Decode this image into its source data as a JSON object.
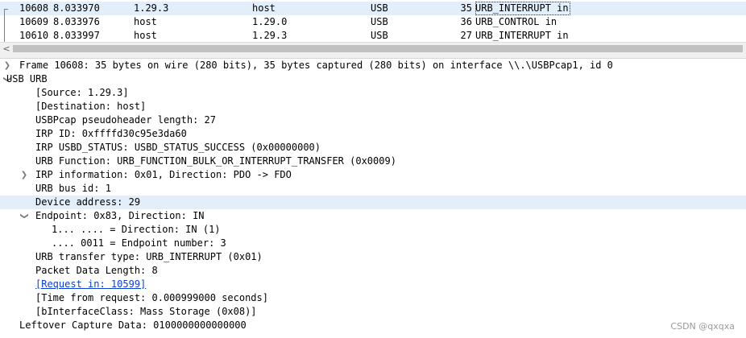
{
  "packet_list": {
    "rows": [
      {
        "no": "10608",
        "time": "8.033970",
        "source": "1.29.3",
        "destination": "host",
        "protocol": "USB",
        "length": "35",
        "info": "URB_INTERRUPT in"
      },
      {
        "no": "10609",
        "time": "8.033976",
        "source": "host",
        "destination": "1.29.0",
        "protocol": "USB",
        "length": "36",
        "info": "URB_CONTROL in"
      },
      {
        "no": "10610",
        "time": "8.033997",
        "source": "host",
        "destination": "1.29.3",
        "protocol": "USB",
        "length": "27",
        "info": "URB_INTERRUPT in"
      }
    ]
  },
  "scrollbar": {
    "left_arrow": "<"
  },
  "details": {
    "frame": "Frame 10608: 35 bytes on wire (280 bits), 35 bytes captured (280 bits) on interface \\\\.\\USBPcap1, id 0",
    "usb_urb": "USB URB",
    "fields": [
      "[Source: 1.29.3]",
      "[Destination: host]",
      "USBPcap pseudoheader length: 27",
      "IRP ID: 0xffffd30c95e3da60",
      "IRP USBD_STATUS: USBD_STATUS_SUCCESS (0x00000000)",
      "URB Function: URB_FUNCTION_BULK_OR_INTERRUPT_TRANSFER (0x0009)",
      "IRP information: 0x01, Direction: PDO -> FDO",
      "URB bus id: 1",
      "Device address: 29",
      "Endpoint: 0x83, Direction: IN",
      "1... .... = Direction: IN (1)",
      ".... 0011 = Endpoint number: 3",
      "URB transfer type: URB_INTERRUPT (0x01)",
      "Packet Data Length: 8",
      "[Request in: 10599]",
      "[Time from request: 0.000999000 seconds]",
      "[bInterfaceClass: Mass Storage (0x08)]"
    ],
    "leftover": "Leftover Capture Data: 0100000000000000"
  },
  "icons": {
    "collapsed": "chevron-right-icon",
    "expanded": "chevron-down-icon"
  },
  "colors": {
    "selection": "#e2eefa",
    "link": "#0b3fd1"
  },
  "watermark": "CSDN @qxqxa"
}
